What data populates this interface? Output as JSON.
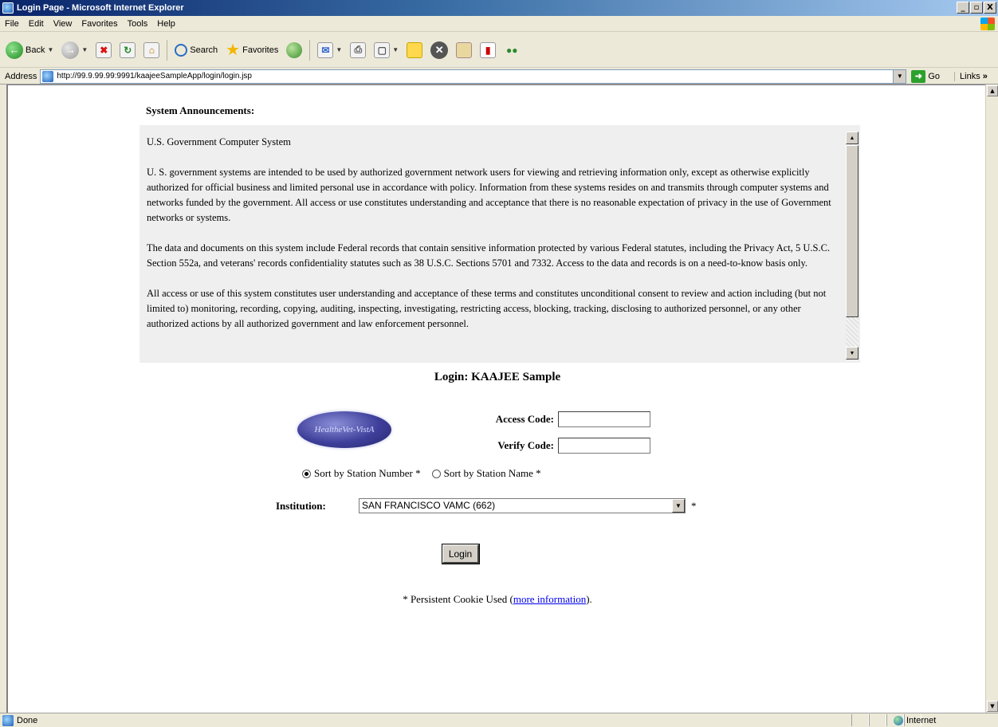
{
  "window": {
    "title": "Login Page - Microsoft Internet Explorer",
    "controls": {
      "minimize": "_",
      "maximize": "▫",
      "close": "X"
    }
  },
  "menu": [
    "File",
    "Edit",
    "View",
    "Favorites",
    "Tools",
    "Help"
  ],
  "toolbar": {
    "back": "Back",
    "search": "Search",
    "favorites": "Favorites"
  },
  "address": {
    "label": "Address",
    "url": "http://99.9.99.99:9991/kaajeeSampleApp/login/login.jsp",
    "go": "Go",
    "links": "Links"
  },
  "announcements": {
    "heading": "System Announcements:",
    "paragraphs": [
      "U.S. Government Computer System",
      "U. S. government systems are intended to be used by authorized government network users for viewing and retrieving information only, except as otherwise explicitly authorized for official business and limited personal use in accordance with policy. Information from these systems resides on and transmits through computer systems and networks funded by the government. All access or use constitutes understanding and acceptance that there is no reasonable expectation of privacy in the use of Government networks or systems.",
      "The data and documents on this system include Federal records that contain sensitive information protected by various Federal statutes, including the Privacy Act, 5 U.S.C. Section 552a, and veterans' records confidentiality statutes such as 38 U.S.C. Sections 5701 and 7332. Access to the data and records is on a need-to-know basis only.",
      "All access or use of this system constitutes user understanding and acceptance of these terms and constitutes unconditional consent to review and action including (but not limited to) monitoring, recording, copying, auditing, inspecting, investigating, restricting access, blocking, tracking, disclosing to authorized personnel, or any other authorized actions by all authorized government and law enforcement personnel."
    ]
  },
  "login": {
    "title": "Login: KAAJEE Sample",
    "logo_text": "HealtheVet-VistA",
    "access_code_label": "Access Code:",
    "access_code_value": "",
    "verify_code_label": "Verify Code:",
    "verify_code_value": "",
    "sort_by_number": "Sort by Station Number *",
    "sort_by_name": "Sort by Station Name *",
    "sort_selected": "number",
    "institution_label": "Institution:",
    "institution_value": "SAN FRANCISCO VAMC (662)",
    "required_marker": "*",
    "login_button": "Login",
    "cookie_prefix": "* Persistent Cookie Used (",
    "cookie_link": "more information",
    "cookie_suffix": ")."
  },
  "status": {
    "text": "Done",
    "zone": "Internet"
  },
  "colors": {
    "title_bar": "#0A246A",
    "chrome": "#ECE9D8",
    "announcement_bg": "#EFEFEF",
    "link": "#0000EE"
  }
}
